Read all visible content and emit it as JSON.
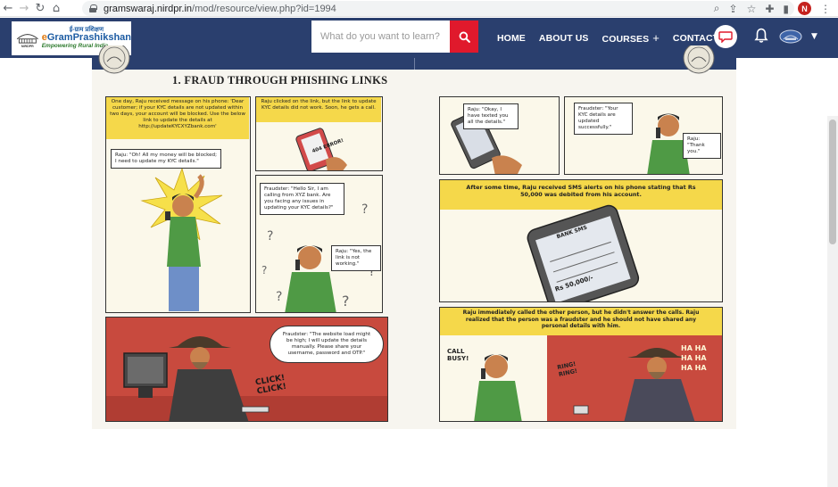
{
  "browser": {
    "url_host": "gramswaraj.nirdpr.in",
    "url_path": "/mod/resource/view.php?id=1994",
    "profile_initial": "N"
  },
  "header": {
    "logo": {
      "hindi": "ई-ग्राम प्रशिक्षण",
      "brand_prefix": "e",
      "brand_name": "GramPrashikshan",
      "tagline": "Empowering Rural India",
      "emblem_label": "NIRDPR"
    },
    "search": {
      "placeholder": "What do you want to learn?"
    },
    "nav": [
      {
        "label": "HOME"
      },
      {
        "label": "ABOUT US"
      },
      {
        "label": "COURSES",
        "suffix": "+"
      },
      {
        "label": "CONTACT US"
      }
    ]
  },
  "comic": {
    "title": "1. FRAUD THROUGH PHISHING LINKS",
    "panel1_caption": "One day, Raju received message on his phone: 'Dear customer; if your KYC details are not updated within two days, your account will be blocked. Use the below link to update the details at http://updateKYCXYZbank.com'",
    "panel1_bubble": "Raju: \"Oh! All my money will be blocked; I need to update my KYC details.\"",
    "panel2_caption": "Raju clicked on the link, but the link to update KYC details did not work. Soon, he gets a call.",
    "panel2_phone_text": "404 ERROR!",
    "panel3_bubble_fraudster": "Fraudster: \"Hello Sir, I am calling from XYZ bank. Are you facing any issues in updating your KYC details?\"",
    "panel3_bubble_raju": "Raju: \"Yes, the link is not working.\"",
    "panel4_bubble": "Fraudster: \"The website load might be high; I will update the details manually. Please share your username, password and OTP.\"",
    "panel4_sfx": "CLICK! CLICK!",
    "panel5_bubble": "Raju: \"Okay, I have texted you all the details.\"",
    "panel6_bubble_fraudster": "Fraudster: \"Your KYC details are updated successfully.\"",
    "panel6_bubble_raju": "Raju: \"Thank you.\"",
    "panel7_caption": "After some time, Raju received SMS alerts on his phone stating that Rs 50,000 was debited from his account.",
    "panel7_phone_header": "BANK SMS",
    "panel7_phone_amount": "Rs 50,000/-",
    "panel8_caption": "Raju immediately called the other person, but he didn't answer the calls. Raju realized that the person was a fraudster and he should not have shared any personal details with him.",
    "panel8_sfx_call": "CALL BUSY!",
    "panel8_sfx_ring": "RING! RING!",
    "panel8_sfx_laugh": "HA HA HA HA HA HA"
  }
}
